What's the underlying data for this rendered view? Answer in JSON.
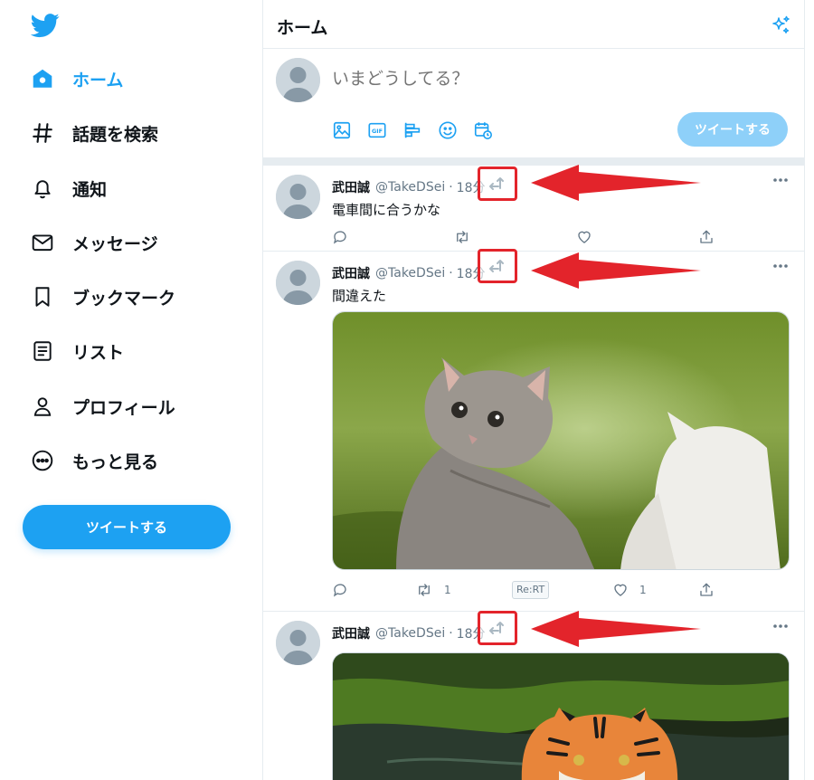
{
  "sidebar": {
    "logo": "twitter-bird-icon",
    "items": [
      {
        "label": "ホーム",
        "icon": "home-icon",
        "active": true
      },
      {
        "label": "話題を検索",
        "icon": "hashtag-icon"
      },
      {
        "label": "通知",
        "icon": "bell-icon"
      },
      {
        "label": "メッセージ",
        "icon": "envelope-icon"
      },
      {
        "label": "ブックマーク",
        "icon": "bookmark-icon"
      },
      {
        "label": "リスト",
        "icon": "list-icon"
      },
      {
        "label": "プロフィール",
        "icon": "person-icon"
      },
      {
        "label": "もっと見る",
        "icon": "more-circle-icon"
      }
    ],
    "tweet_button": "ツイートする"
  },
  "header": {
    "title": "ホーム",
    "icon": "sparkle-icon"
  },
  "composer": {
    "placeholder": "いまどうしてる？",
    "icons": [
      "image-icon",
      "gif-icon",
      "poll-icon",
      "emoji-icon",
      "schedule-icon"
    ],
    "submit_label": "ツイートする"
  },
  "tweets": [
    {
      "name": "武田誠",
      "handle": "@TakeDSei",
      "dot": "·",
      "time": "18分",
      "text": "電車間に合うかな",
      "actions": {
        "reply": "",
        "retweet": "",
        "like": ""
      }
    },
    {
      "name": "武田誠",
      "handle": "@TakeDSei",
      "dot": "·",
      "time": "18分",
      "text": "間違えた",
      "media": "kittens-photo",
      "actions": {
        "reply": "",
        "retweet": "1",
        "rert": "Re:RT",
        "like": "1"
      }
    },
    {
      "name": "武田誠",
      "handle": "@TakeDSei",
      "dot": "·",
      "time": "18分",
      "text": "",
      "media": "tiger-photo"
    }
  ],
  "colors": {
    "accent": "#1da1f2",
    "accent_disabled": "#8ed0f9",
    "annotation_red": "#e3242b",
    "muted_text": "#657786",
    "border": "#e6ecf0"
  }
}
